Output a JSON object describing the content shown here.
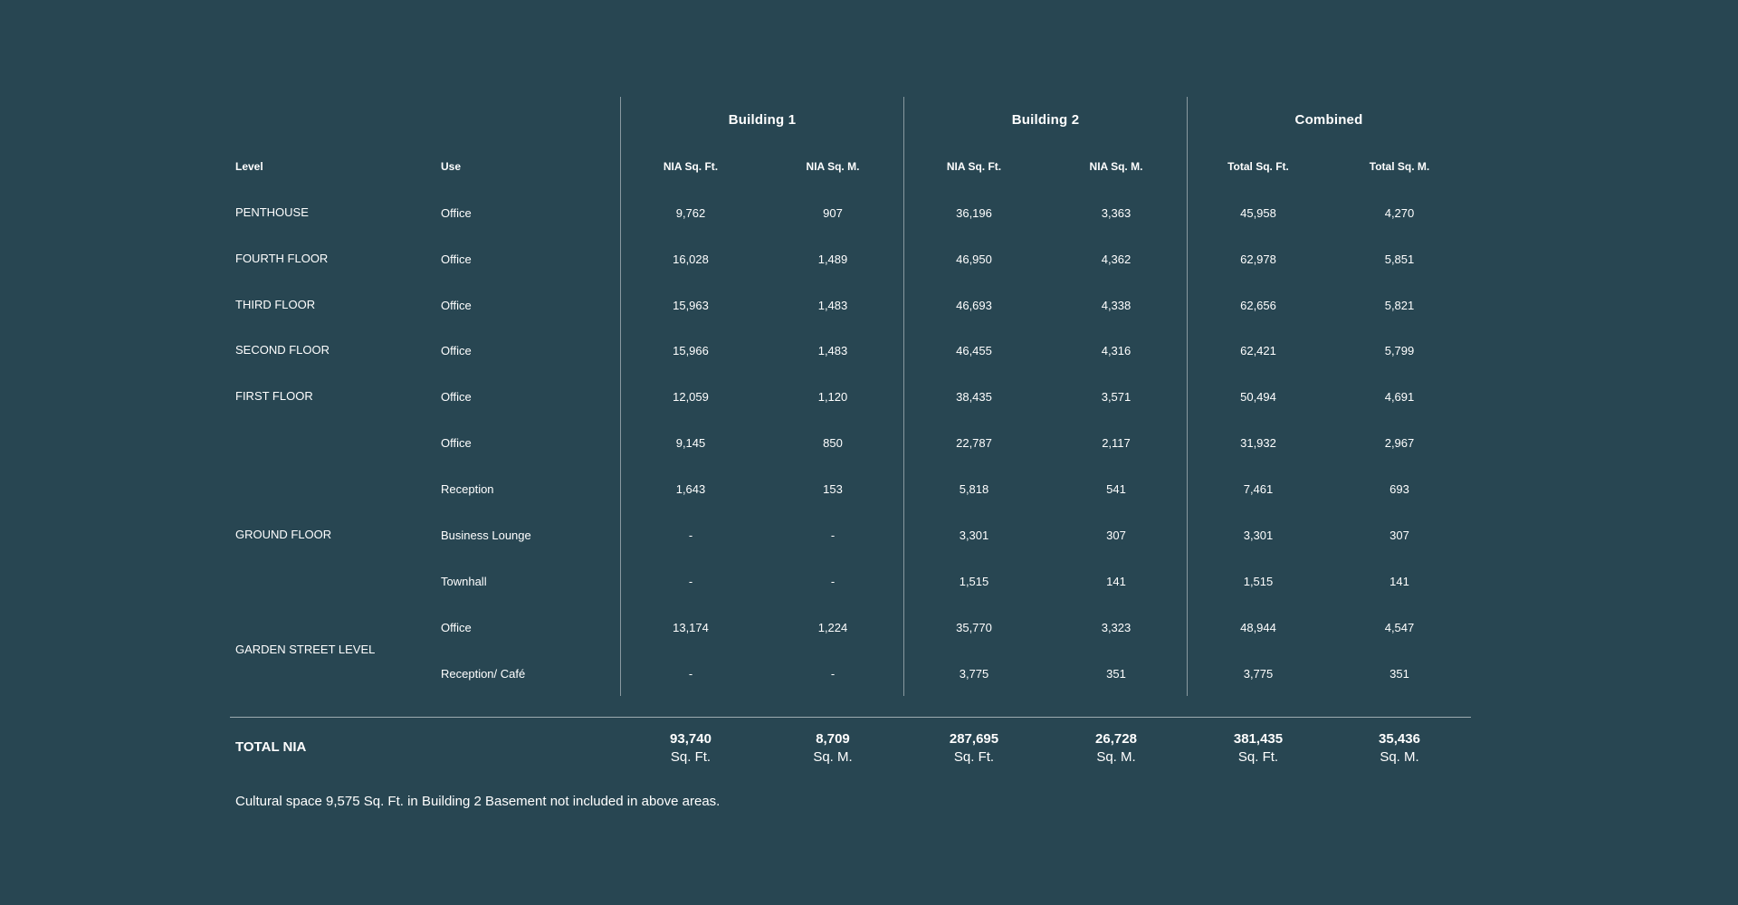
{
  "groups": [
    "Building 1",
    "Building 2",
    "Combined"
  ],
  "headers": {
    "level": "Level",
    "use": "Use",
    "cols": [
      "NIA Sq. Ft.",
      "NIA Sq. M.",
      "NIA Sq. Ft.",
      "NIA Sq. M.",
      "Total Sq. Ft.",
      "Total Sq. M."
    ]
  },
  "levels": [
    "PENTHOUSE",
    "FOURTH FLOOR",
    "THIRD FLOOR",
    "SECOND FLOOR",
    "FIRST FLOOR",
    "GROUND FLOOR",
    "GARDEN STREET LEVEL"
  ],
  "rows": [
    {
      "use": "Office",
      "values": [
        "9,762",
        "907",
        "36,196",
        "3,363",
        "45,958",
        "4,270"
      ]
    },
    {
      "use": "Office",
      "values": [
        "16,028",
        "1,489",
        "46,950",
        "4,362",
        "62,978",
        "5,851"
      ]
    },
    {
      "use": "Office",
      "values": [
        "15,963",
        "1,483",
        "46,693",
        "4,338",
        "62,656",
        "5,821"
      ]
    },
    {
      "use": "Office",
      "values": [
        "15,966",
        "1,483",
        "46,455",
        "4,316",
        "62,421",
        "5,799"
      ]
    },
    {
      "use": "Office",
      "values": [
        "12,059",
        "1,120",
        "38,435",
        "3,571",
        "50,494",
        "4,691"
      ]
    },
    {
      "use": "Office",
      "values": [
        "9,145",
        "850",
        "22,787",
        "2,117",
        "31,932",
        "2,967"
      ]
    },
    {
      "use": "Reception",
      "values": [
        "1,643",
        "153",
        "5,818",
        "541",
        "7,461",
        "693"
      ]
    },
    {
      "use": "Business Lounge",
      "values": [
        "-",
        "-",
        "3,301",
        "307",
        "3,301",
        "307"
      ]
    },
    {
      "use": "Townhall",
      "values": [
        "-",
        "-",
        "1,515",
        "141",
        "1,515",
        "141"
      ]
    },
    {
      "use": "Office",
      "values": [
        "13,174",
        "1,224",
        "35,770",
        "3,323",
        "48,944",
        "4,547"
      ]
    },
    {
      "use": "Reception/ Café",
      "values": [
        "-",
        "-",
        "3,775",
        "351",
        "3,775",
        "351"
      ]
    }
  ],
  "total": {
    "label": "TOTAL NIA",
    "values": [
      "93,740",
      "8,709",
      "287,695",
      "26,728",
      "381,435",
      "35,436"
    ],
    "units": [
      "Sq. Ft.",
      "Sq. M.",
      "Sq. Ft.",
      "Sq. M.",
      "Sq. Ft.",
      "Sq. M."
    ]
  },
  "footnote": "Cultural space 9,575 Sq. Ft. in Building 2 Basement not included in above areas."
}
